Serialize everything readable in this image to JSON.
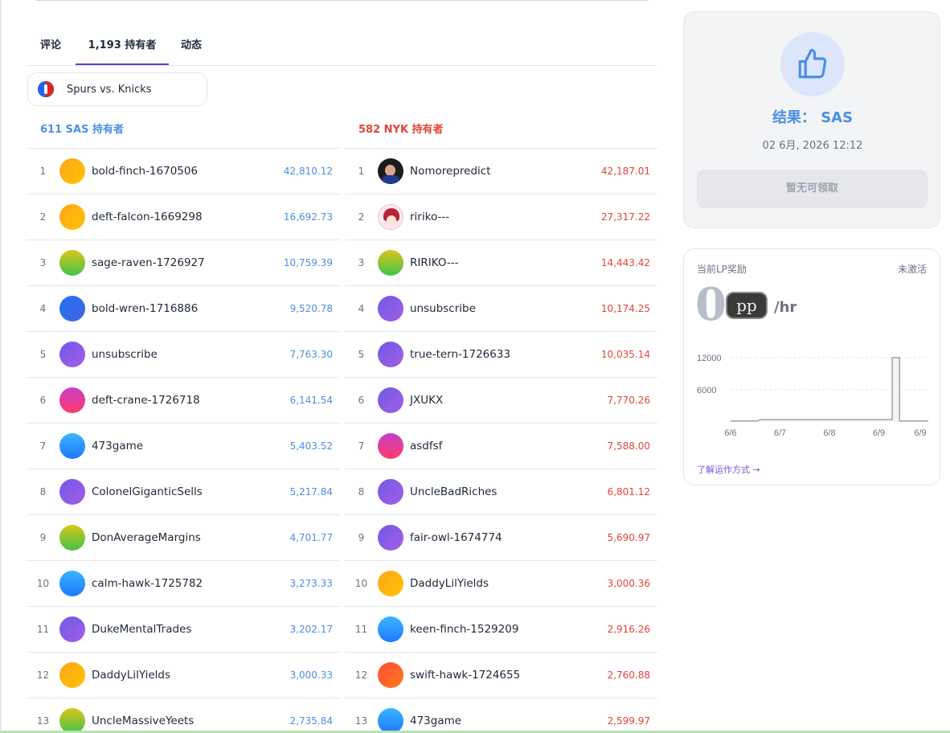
{
  "tabs": [
    {
      "label": "评论"
    },
    {
      "label": "1,193 持有者",
      "active": true
    },
    {
      "label": "动态"
    }
  ],
  "market": {
    "label": "Spurs vs. Knicks",
    "icon": "nba-logo-icon"
  },
  "left_column": {
    "header": "611 SAS 持有者",
    "color": "#4a90e2",
    "rows": [
      {
        "rank": "1",
        "name": "bold-finch-1670506",
        "amount": "42,810.12",
        "avatar": "g-orange"
      },
      {
        "rank": "2",
        "name": "deft-falcon-1669298",
        "amount": "16,692.73",
        "avatar": "g-orange"
      },
      {
        "rank": "3",
        "name": "sage-raven-1726927",
        "amount": "10,759.39",
        "avatar": "g-lime"
      },
      {
        "rank": "4",
        "name": "bold-wren-1716886",
        "amount": "9,520.78",
        "avatar": "g-blue"
      },
      {
        "rank": "5",
        "name": "unsubscribe",
        "amount": "7,763.30",
        "avatar": "g-purple"
      },
      {
        "rank": "6",
        "name": "deft-crane-1726718",
        "amount": "6,141.54",
        "avatar": "g-pink"
      },
      {
        "rank": "7",
        "name": "473game",
        "amount": "5,403.52",
        "avatar": "g-sky"
      },
      {
        "rank": "8",
        "name": "ColonelGiganticSells",
        "amount": "5,217.84",
        "avatar": "g-purple"
      },
      {
        "rank": "9",
        "name": "DonAverageMargins",
        "amount": "4,701.77",
        "avatar": "g-lime"
      },
      {
        "rank": "10",
        "name": "calm-hawk-1725782",
        "amount": "3,273.33",
        "avatar": "g-sky"
      },
      {
        "rank": "11",
        "name": "DukeMentalTrades",
        "amount": "3,202.17",
        "avatar": "g-purple"
      },
      {
        "rank": "12",
        "name": "DaddyLilYields",
        "amount": "3,000.33",
        "avatar": "g-orange"
      },
      {
        "rank": "13",
        "name": "UncleMassiveYeets",
        "amount": "2,735.84",
        "avatar": "g-lime"
      }
    ]
  },
  "right_column": {
    "header": "582 NYK 持有者",
    "color": "#e0453a",
    "rows": [
      {
        "rank": "1",
        "name": "Nomorepredict",
        "amount": "42,187.01",
        "avatar": "photo1"
      },
      {
        "rank": "2",
        "name": "ririko---",
        "amount": "27,317.22",
        "avatar": "photo2"
      },
      {
        "rank": "3",
        "name": "RIRIKO---",
        "amount": "14,443.42",
        "avatar": "g-lime"
      },
      {
        "rank": "4",
        "name": "unsubscribe",
        "amount": "10,174.25",
        "avatar": "g-purple"
      },
      {
        "rank": "5",
        "name": "true-tern-1726633",
        "amount": "10,035.14",
        "avatar": "g-purple"
      },
      {
        "rank": "6",
        "name": "JXUKX",
        "amount": "7,770.26",
        "avatar": "g-purple"
      },
      {
        "rank": "7",
        "name": "asdfsf",
        "amount": "7,588.00",
        "avatar": "g-pink"
      },
      {
        "rank": "8",
        "name": "UncleBadRiches",
        "amount": "6,801.12",
        "avatar": "g-purple"
      },
      {
        "rank": "9",
        "name": "fair-owl-1674774",
        "amount": "5,690.97",
        "avatar": "g-purple"
      },
      {
        "rank": "10",
        "name": "DaddyLilYields",
        "amount": "3,000.36",
        "avatar": "g-orange"
      },
      {
        "rank": "11",
        "name": "keen-finch-1529209",
        "amount": "2,916.26",
        "avatar": "g-sky"
      },
      {
        "rank": "12",
        "name": "swift-hawk-1724655",
        "amount": "2,760.88",
        "avatar": "g-red"
      },
      {
        "rank": "13",
        "name": "473game",
        "amount": "2,599.97",
        "avatar": "g-sky"
      }
    ]
  },
  "result": {
    "icon": "thumbs-up-icon",
    "title": "结果： SAS",
    "date": "02 6月, 2026 12:12",
    "button_label": "暂无可领取",
    "accent": "#4a90e2"
  },
  "lp_reward": {
    "label": "当前LP奖励",
    "status": "未激活",
    "value": "0",
    "badge": "pp",
    "unit": "/hr",
    "link_label": "了解运作方式 →"
  },
  "chart_data": {
    "type": "area",
    "x": [
      "6/6",
      "6/7",
      "6/8",
      "6/9",
      "6/9"
    ],
    "y_ticks": [
      6000,
      12000
    ],
    "ylim": [
      0,
      12000
    ],
    "grid": true,
    "series": [
      {
        "points": [
          {
            "x": 0.0,
            "y": 200
          },
          {
            "x": 0.55,
            "y": 200
          },
          {
            "x": 0.6,
            "y": 450
          },
          {
            "x": 3.27,
            "y": 450
          },
          {
            "x": 3.27,
            "y": 12000
          },
          {
            "x": 3.42,
            "y": 12000
          },
          {
            "x": 3.42,
            "y": 200
          },
          {
            "x": 4.0,
            "y": 200
          }
        ]
      }
    ],
    "color": "#9ca3af"
  }
}
